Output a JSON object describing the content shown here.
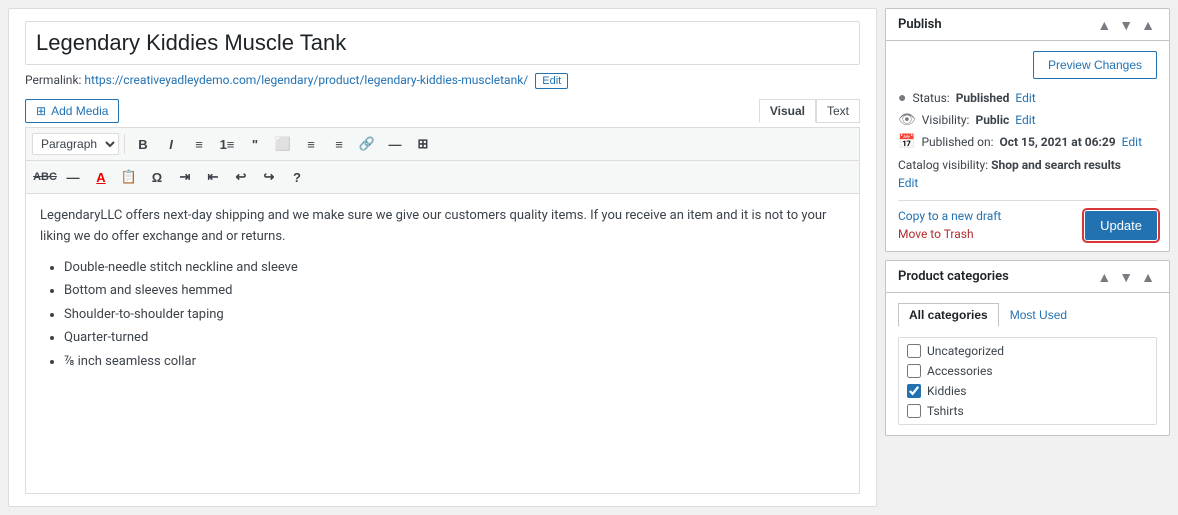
{
  "post": {
    "title": "Legendary Kiddies Muscle Tank",
    "permalink_label": "Permalink:",
    "permalink_url": "https://creativeyadleydemo.com/legendary/product/legendary-kiddies-muscletank/",
    "edit_btn": "Edit"
  },
  "toolbar": {
    "add_media": "Add Media",
    "visual_tab": "Visual",
    "text_tab": "Text",
    "paragraph_select": "Paragraph"
  },
  "editor": {
    "body_text": "LegendaryLLC offers next-day shipping and we make sure we give our customers quality items. If you receive an item and it is not to your liking we do offer exchange and or returns.",
    "bullet_items": [
      "Double-needle stitch neckline and sleeve",
      "Bottom and sleeves hemmed",
      "Shoulder-to-shoulder taping",
      "Quarter-turned",
      "⅞ inch seamless collar"
    ]
  },
  "publish": {
    "title": "Publish",
    "preview_changes": "Preview Changes",
    "status_label": "Status:",
    "status_value": "Published",
    "status_edit": "Edit",
    "visibility_label": "Visibility:",
    "visibility_value": "Public",
    "visibility_edit": "Edit",
    "published_label": "Published on:",
    "published_value": "Oct 15, 2021 at 06:29",
    "published_edit": "Edit",
    "catalog_label": "Catalog visibility:",
    "catalog_value": "Shop and search results",
    "catalog_edit": "Edit",
    "copy_draft": "Copy to a new draft",
    "move_trash": "Move to Trash",
    "update_btn": "Update"
  },
  "product_categories": {
    "title": "Product categories",
    "tab_all": "All categories",
    "tab_most_used": "Most Used",
    "categories": [
      {
        "label": "Uncategorized",
        "checked": false
      },
      {
        "label": "Accessories",
        "checked": false
      },
      {
        "label": "Kiddies",
        "checked": true
      },
      {
        "label": "Tshirts",
        "checked": false
      }
    ]
  },
  "icons": {
    "up_arrow": "▲",
    "down_arrow": "▼",
    "toggle_arrow": "▾",
    "calendar": "📅",
    "eye": "👁",
    "lock": "🔒",
    "media_icon": "🖼"
  }
}
